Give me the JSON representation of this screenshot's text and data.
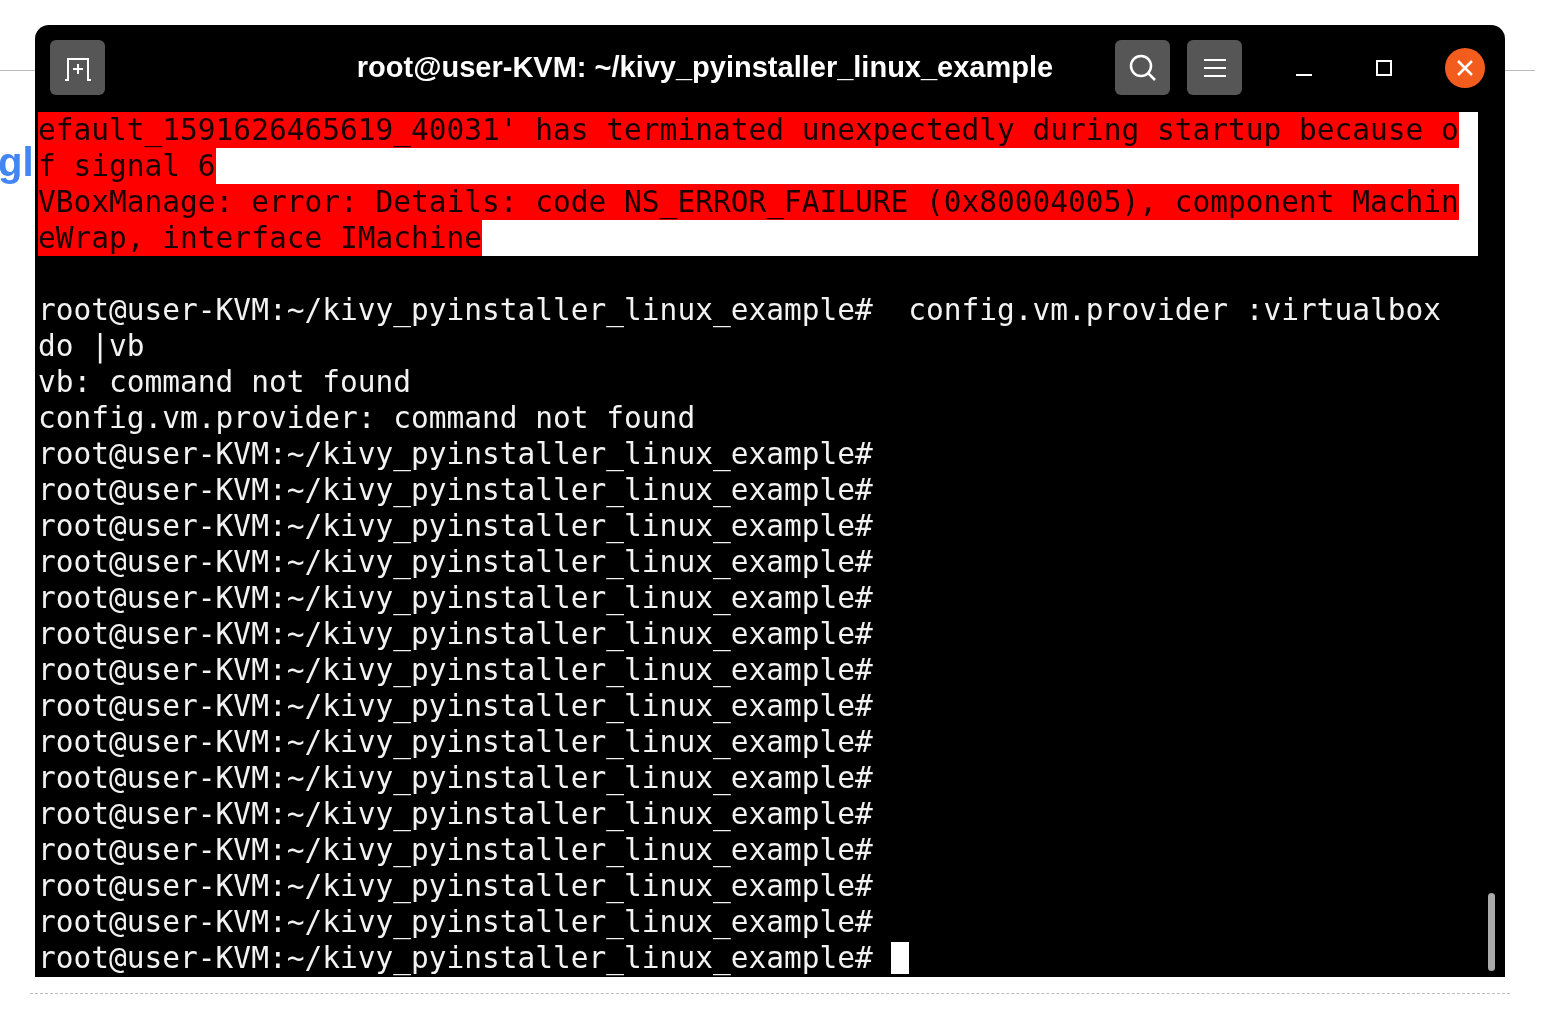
{
  "background": {
    "logo_text": "gl"
  },
  "window": {
    "title": "root@user-KVM: ~/kivy_pyinstaller_linux_example"
  },
  "terminal": {
    "cursor_visible": true,
    "lines": [
      {
        "kind": "error",
        "text": "efault_1591626465619_40031' has terminated unexpectedly during startup because o"
      },
      {
        "kind": "error",
        "text": "f signal 6"
      },
      {
        "kind": "error",
        "text": "VBoxManage: error: Details: code NS_ERROR_FAILURE (0x80004005), component Machin"
      },
      {
        "kind": "error",
        "text": "eWrap, interface IMachine"
      },
      {
        "kind": "blank"
      },
      {
        "kind": "output",
        "text": "root@user-KVM:~/kivy_pyinstaller_linux_example#  config.vm.provider :virtualbox"
      },
      {
        "kind": "output",
        "text": "do |vb"
      },
      {
        "kind": "output",
        "text": "vb: command not found"
      },
      {
        "kind": "output",
        "text": "config.vm.provider: command not found"
      },
      {
        "kind": "output",
        "text": "root@user-KVM:~/kivy_pyinstaller_linux_example#"
      },
      {
        "kind": "output",
        "text": "root@user-KVM:~/kivy_pyinstaller_linux_example#"
      },
      {
        "kind": "output",
        "text": "root@user-KVM:~/kivy_pyinstaller_linux_example#"
      },
      {
        "kind": "output",
        "text": "root@user-KVM:~/kivy_pyinstaller_linux_example#"
      },
      {
        "kind": "output",
        "text": "root@user-KVM:~/kivy_pyinstaller_linux_example#"
      },
      {
        "kind": "output",
        "text": "root@user-KVM:~/kivy_pyinstaller_linux_example#"
      },
      {
        "kind": "output",
        "text": "root@user-KVM:~/kivy_pyinstaller_linux_example#"
      },
      {
        "kind": "output",
        "text": "root@user-KVM:~/kivy_pyinstaller_linux_example#"
      },
      {
        "kind": "output",
        "text": "root@user-KVM:~/kivy_pyinstaller_linux_example#"
      },
      {
        "kind": "output",
        "text": "root@user-KVM:~/kivy_pyinstaller_linux_example#"
      },
      {
        "kind": "output",
        "text": "root@user-KVM:~/kivy_pyinstaller_linux_example#"
      },
      {
        "kind": "output",
        "text": "root@user-KVM:~/kivy_pyinstaller_linux_example#"
      },
      {
        "kind": "output",
        "text": "root@user-KVM:~/kivy_pyinstaller_linux_example#"
      },
      {
        "kind": "output",
        "text": "root@user-KVM:~/kivy_pyinstaller_linux_example#"
      },
      {
        "kind": "output",
        "text": "root@user-KVM:~/kivy_pyinstaller_linux_example#"
      }
    ]
  }
}
